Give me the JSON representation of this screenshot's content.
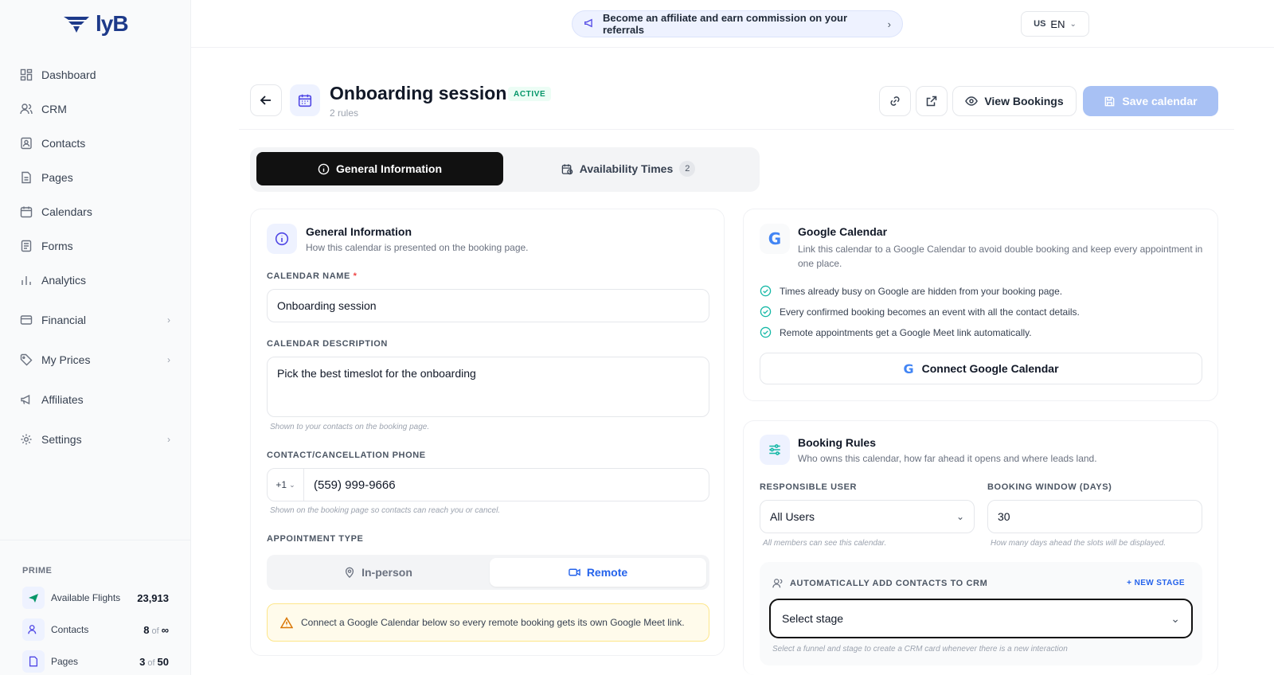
{
  "brand": {
    "logo_text": "lyB"
  },
  "sidebar": {
    "items": [
      {
        "label": "Dashboard",
        "icon": "dashboard-icon",
        "has_children": false
      },
      {
        "label": "CRM",
        "icon": "users-icon",
        "has_children": false
      },
      {
        "label": "Contacts",
        "icon": "contacts-icon",
        "has_children": false
      },
      {
        "label": "Pages",
        "icon": "page-icon",
        "has_children": false
      },
      {
        "label": "Calendars",
        "icon": "calendar-icon",
        "has_children": false
      },
      {
        "label": "Forms",
        "icon": "form-icon",
        "has_children": false
      },
      {
        "label": "Analytics",
        "icon": "analytics-icon",
        "has_children": false
      },
      {
        "label": "Financial",
        "icon": "card-icon",
        "has_children": true
      },
      {
        "label": "My Prices",
        "icon": "tag-icon",
        "has_children": true
      },
      {
        "label": "Affiliates",
        "icon": "megaphone-icon",
        "has_children": false
      },
      {
        "label": "Settings",
        "icon": "gear-icon",
        "has_children": true
      }
    ],
    "prime": {
      "title": "PRIME",
      "rows": [
        {
          "label": "Available Flights",
          "value": "23,913",
          "of": "",
          "max": ""
        },
        {
          "label": "Contacts",
          "value": "8",
          "of": "of",
          "max": "∞"
        },
        {
          "label": "Pages",
          "value": "3",
          "of": "of",
          "max": "50"
        }
      ]
    }
  },
  "topbar": {
    "affiliate_text": "Become an affiliate and earn commission on your referrals",
    "lang_flag": "US",
    "lang_code": "EN"
  },
  "header": {
    "title": "Onboarding session",
    "status": "ACTIVE",
    "subtitle": "2 rules",
    "view_bookings": "View Bookings",
    "save": "Save calendar"
  },
  "tabs": {
    "general": "General Information",
    "availability": "Availability Times",
    "availability_count": "2"
  },
  "general": {
    "title": "General Information",
    "subtitle": "How this calendar is presented on the booking page.",
    "name_label": "CALENDAR NAME",
    "name_value": "Onboarding session",
    "desc_label": "CALENDAR DESCRIPTION",
    "desc_value": "Pick the best timeslot for the onboarding",
    "desc_hint": "Shown to your contacts on the booking page.",
    "phone_label": "CONTACT/CANCELLATION PHONE",
    "phone_prefix": "+1",
    "phone_value": "(559) 999-9666",
    "phone_hint": "Shown on the booking page so contacts can reach you or cancel.",
    "appt_label": "APPOINTMENT TYPE",
    "appt_inperson": "In-person",
    "appt_remote": "Remote",
    "warning": "Connect a Google Calendar below so every remote booking gets its own Google Meet link."
  },
  "google": {
    "title": "Google Calendar",
    "subtitle": "Link this calendar to a Google Calendar to avoid double booking and keep every appointment in one place.",
    "checks": [
      "Times already busy on Google are hidden from your booking page.",
      "Every confirmed booking becomes an event with all the contact details.",
      "Remote appointments get a Google Meet link automatically."
    ],
    "connect": "Connect Google Calendar"
  },
  "rules": {
    "title": "Booking Rules",
    "subtitle": "Who owns this calendar, how far ahead it opens and where leads land.",
    "user_label": "RESPONSIBLE USER",
    "user_value": "All Users",
    "user_hint": "All members can see this calendar.",
    "window_label": "BOOKING WINDOW (DAYS)",
    "window_value": "30",
    "window_hint": "How many days ahead the slots will be displayed.",
    "crm_label": "AUTOMATICALLY ADD CONTACTS TO CRM",
    "new_stage": "NEW STAGE",
    "stage_placeholder": "Select stage",
    "stage_hint": "Select a funnel and stage to create a CRM card whenever there is a new interaction"
  },
  "colors": {
    "accent": "#2563eb",
    "save_disabled": "#a8c1f4",
    "active_green": "#059669"
  }
}
